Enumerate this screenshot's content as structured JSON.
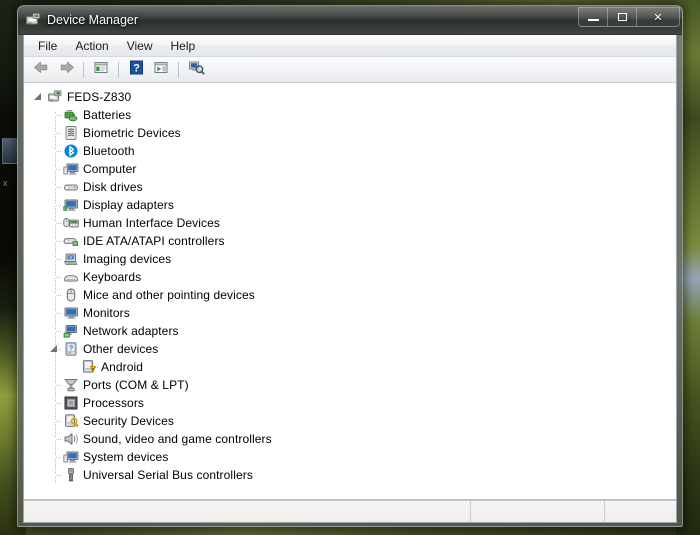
{
  "window": {
    "title": "Device Manager",
    "app_icon": "device-manager-icon",
    "caption": {
      "minimize": "minimize-icon",
      "maximize": "maximize-icon",
      "close_label": "✕"
    }
  },
  "menubar": {
    "items": [
      {
        "label": "File",
        "name": "menu-file"
      },
      {
        "label": "Action",
        "name": "menu-action"
      },
      {
        "label": "View",
        "name": "menu-view"
      },
      {
        "label": "Help",
        "name": "menu-help"
      }
    ]
  },
  "toolbar": {
    "buttons": [
      {
        "name": "back-button",
        "icon": "back-arrow-icon",
        "enabled": false
      },
      {
        "name": "forward-button",
        "icon": "forward-arrow-icon",
        "enabled": false
      },
      {
        "name": "properties-button",
        "icon": "properties-icon",
        "enabled": true
      },
      {
        "name": "help-button",
        "icon": "help-question-icon",
        "enabled": true
      },
      {
        "name": "update-driver-button",
        "icon": "update-driver-icon",
        "enabled": true
      },
      {
        "name": "scan-hardware-button",
        "icon": "scan-hardware-icon",
        "enabled": true
      }
    ]
  },
  "tree": {
    "root": {
      "label": "FEDS-Z830",
      "icon": "computer-root-icon",
      "expanded": true
    },
    "nodes": [
      {
        "label": "Batteries",
        "icon": "battery-icon",
        "expanded": false,
        "level": 1
      },
      {
        "label": "Biometric Devices",
        "icon": "biometric-icon",
        "expanded": false,
        "level": 1
      },
      {
        "label": "Bluetooth",
        "icon": "bluetooth-icon",
        "expanded": false,
        "level": 1
      },
      {
        "label": "Computer",
        "icon": "computer-icon",
        "expanded": false,
        "level": 1
      },
      {
        "label": "Disk drives",
        "icon": "disk-drive-icon",
        "expanded": false,
        "level": 1
      },
      {
        "label": "Display adapters",
        "icon": "display-icon",
        "expanded": false,
        "level": 1
      },
      {
        "label": "Human Interface Devices",
        "icon": "hid-icon",
        "expanded": false,
        "level": 1
      },
      {
        "label": "IDE ATA/ATAPI controllers",
        "icon": "ide-controller-icon",
        "expanded": false,
        "level": 1
      },
      {
        "label": "Imaging devices",
        "icon": "imaging-icon",
        "expanded": false,
        "level": 1
      },
      {
        "label": "Keyboards",
        "icon": "keyboard-icon",
        "expanded": false,
        "level": 1
      },
      {
        "label": "Mice and other pointing devices",
        "icon": "mouse-icon",
        "expanded": false,
        "level": 1
      },
      {
        "label": "Monitors",
        "icon": "monitor-icon",
        "expanded": false,
        "level": 1
      },
      {
        "label": "Network adapters",
        "icon": "network-icon",
        "expanded": false,
        "level": 1
      },
      {
        "label": "Other devices",
        "icon": "other-devices-icon",
        "expanded": true,
        "level": 1
      },
      {
        "label": "Android",
        "icon": "unknown-device-warning-icon",
        "expanded": null,
        "level": 2
      },
      {
        "label": "Ports (COM & LPT)",
        "icon": "ports-icon",
        "expanded": false,
        "level": 1
      },
      {
        "label": "Processors",
        "icon": "processor-icon",
        "expanded": false,
        "level": 1
      },
      {
        "label": "Security Devices",
        "icon": "security-icon",
        "expanded": false,
        "level": 1
      },
      {
        "label": "Sound, video and game controllers",
        "icon": "sound-icon",
        "expanded": false,
        "level": 1
      },
      {
        "label": "System devices",
        "icon": "system-devices-icon",
        "expanded": false,
        "level": 1
      },
      {
        "label": "Universal Serial Bus controllers",
        "icon": "usb-icon",
        "expanded": false,
        "level": 1
      }
    ]
  },
  "statusbar": {
    "main": "",
    "middle": "",
    "right": ""
  },
  "colors": {
    "title_bar": "#3a3e3c",
    "selection": "#cfe4f7",
    "warning": "#ffc000",
    "tree_text": "#000000",
    "bluetooth": "#0a84d8"
  }
}
